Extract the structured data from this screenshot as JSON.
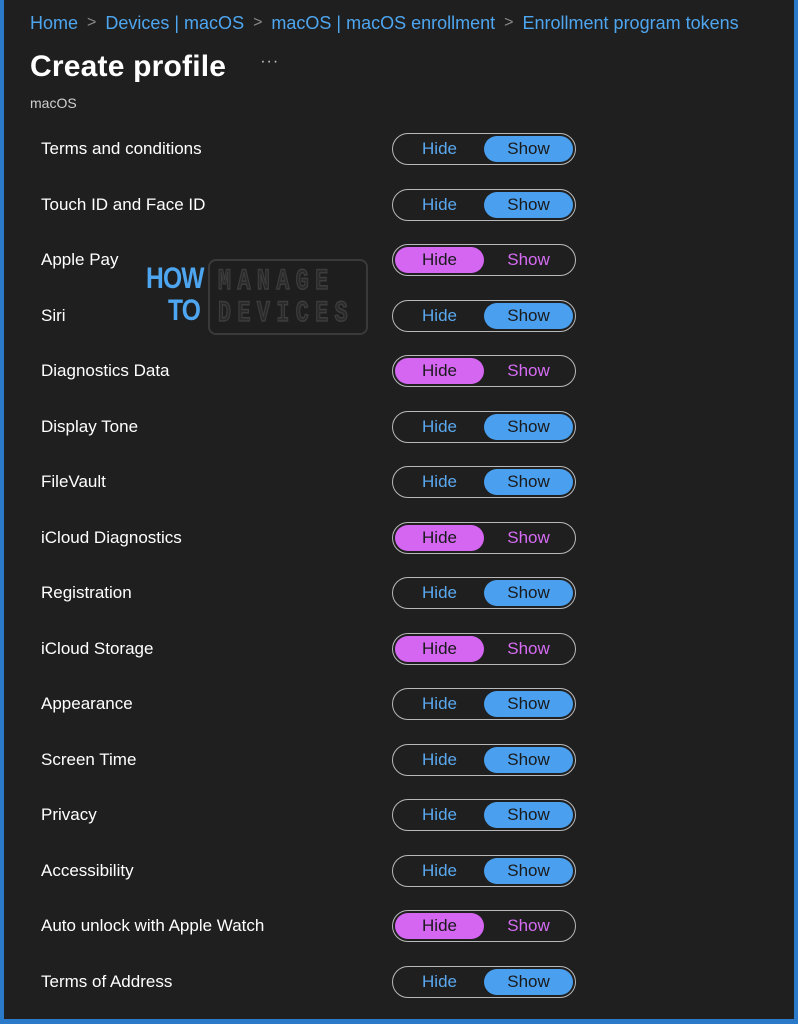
{
  "breadcrumb": {
    "items": [
      "Home",
      "Devices | macOS",
      "macOS | macOS enrollment",
      "Enrollment program tokens"
    ],
    "separator": ">"
  },
  "header": {
    "title": "Create profile",
    "more": "···",
    "subtitle": "macOS"
  },
  "toggle_labels": {
    "hide": "Hide",
    "show": "Show"
  },
  "colors": {
    "accent_blue": "#4a9fee",
    "hide_purple": "#d466f2",
    "frame_border": "#2b79c9"
  },
  "watermark": {
    "line1_left": "HOW",
    "line2_left": "TO",
    "line1_right": "MANAGE",
    "line2_right": "DEVICES"
  },
  "settings": [
    {
      "label": "Terms and conditions",
      "value": "Show"
    },
    {
      "label": "Touch ID and Face ID",
      "value": "Show"
    },
    {
      "label": "Apple Pay",
      "value": "Hide"
    },
    {
      "label": "Siri",
      "value": "Show"
    },
    {
      "label": "Diagnostics Data",
      "value": "Hide"
    },
    {
      "label": "Display Tone",
      "value": "Show"
    },
    {
      "label": "FileVault",
      "value": "Show"
    },
    {
      "label": "iCloud Diagnostics",
      "value": "Hide"
    },
    {
      "label": "Registration",
      "value": "Show"
    },
    {
      "label": "iCloud Storage",
      "value": "Hide"
    },
    {
      "label": "Appearance",
      "value": "Show"
    },
    {
      "label": "Screen Time",
      "value": "Show"
    },
    {
      "label": "Privacy",
      "value": "Show"
    },
    {
      "label": "Accessibility",
      "value": "Show"
    },
    {
      "label": "Auto unlock with Apple Watch",
      "value": "Hide"
    },
    {
      "label": "Terms of Address",
      "value": "Show"
    }
  ]
}
